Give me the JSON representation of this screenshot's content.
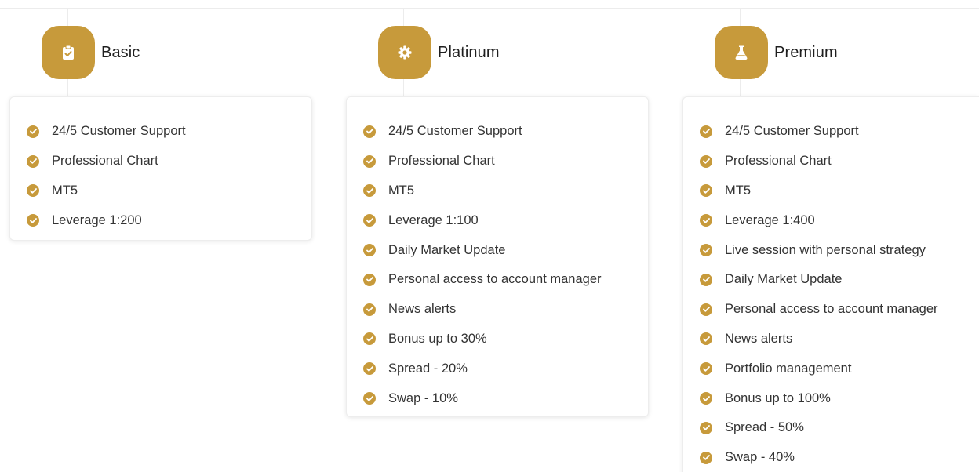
{
  "colors": {
    "accent": "#c79a3b",
    "text": "#333333",
    "heading": "#1f1f1f",
    "border": "#ededed"
  },
  "plans": [
    {
      "name": "Basic",
      "icon": "clipboard-check-icon",
      "features": [
        "24/5 Customer Support",
        "Professional Chart",
        "MT5",
        "Leverage 1:200"
      ]
    },
    {
      "name": "Platinum",
      "icon": "gear-icon",
      "features": [
        "24/5 Customer Support",
        "Professional Chart",
        "MT5",
        "Leverage 1:100",
        "Daily Market Update",
        "Personal access to account manager",
        "News alerts",
        "Bonus up to 30%",
        "Spread - 20%",
        "Swap - 10%"
      ]
    },
    {
      "name": "Premium",
      "icon": "flask-icon",
      "features": [
        "24/5 Customer Support",
        "Professional Chart",
        "MT5",
        "Leverage 1:400",
        "Live session with personal strategy",
        "Daily Market Update",
        "Personal access to account manager",
        "News alerts",
        "Portfolio management",
        "Bonus up to 100%",
        "Spread - 50%",
        "Swap - 40%"
      ]
    }
  ]
}
